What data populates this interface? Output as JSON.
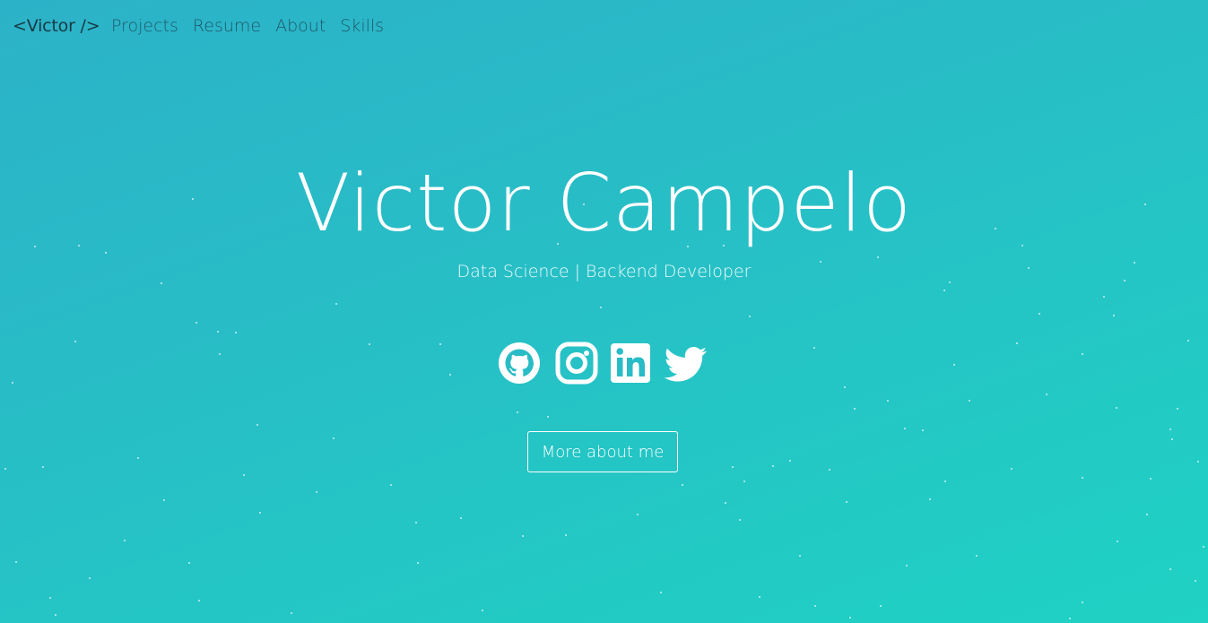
{
  "nav": {
    "brand": "<Victor />",
    "links": [
      {
        "label": "Projects"
      },
      {
        "label": "Resume"
      },
      {
        "label": "About"
      },
      {
        "label": "Skills"
      }
    ]
  },
  "hero": {
    "title": "Victor Campelo",
    "subtitle": "Data Science | Backend Developer",
    "cta_label": "More about me"
  },
  "socials": [
    {
      "icon": "github-icon"
    },
    {
      "icon": "instagram-icon"
    },
    {
      "icon": "linkedin-icon"
    },
    {
      "icon": "twitter-icon"
    }
  ],
  "colors": {
    "background_start": "#2cb2c8",
    "background_end": "#1fd2c3",
    "brand_text": "#173a45",
    "nav_text": "#1e5868",
    "foreground": "#ffffff"
  }
}
